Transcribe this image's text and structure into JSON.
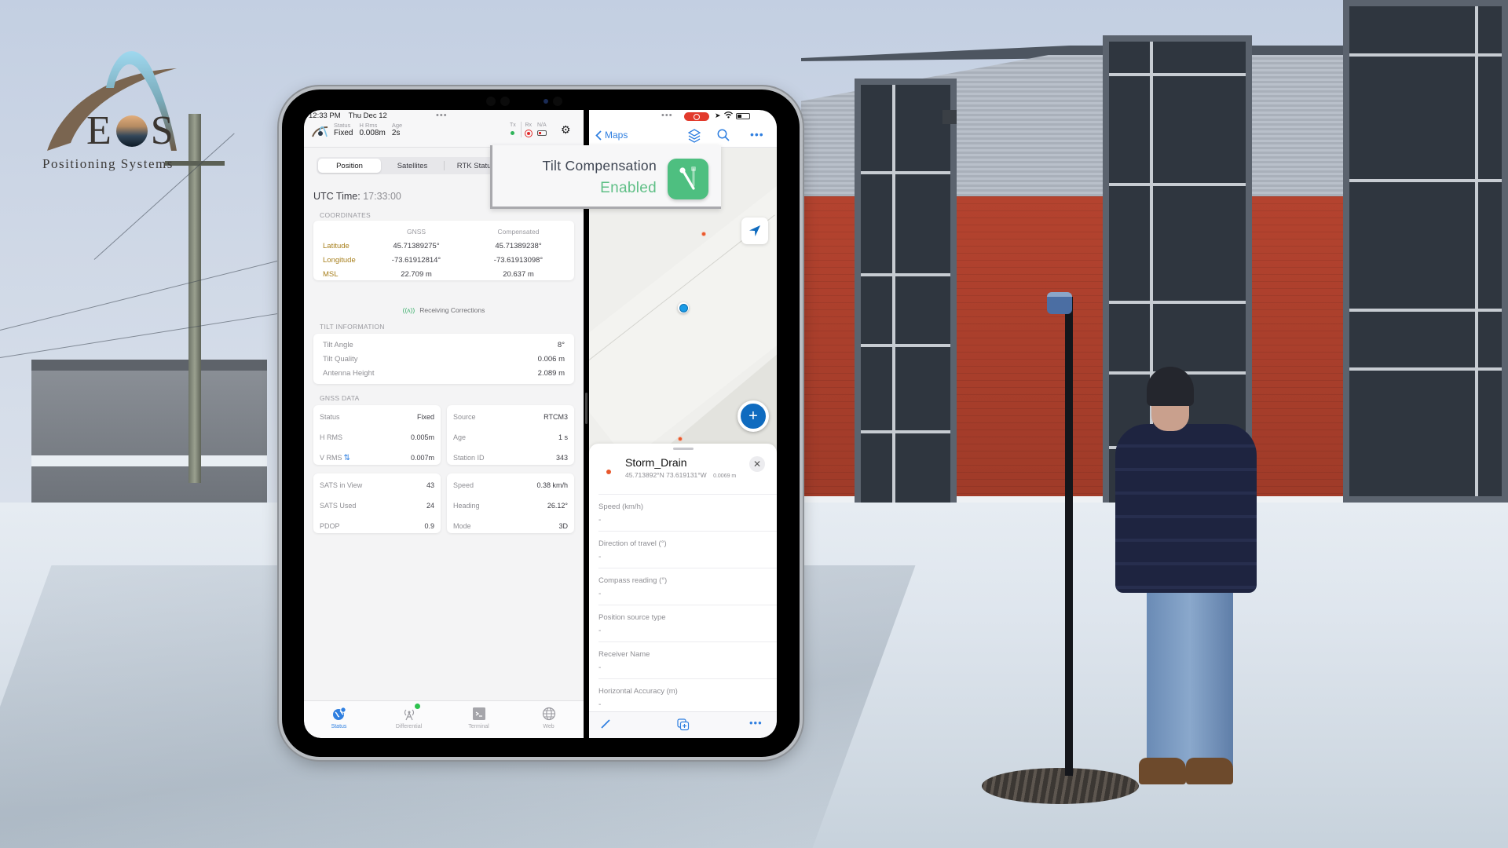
{
  "overlay": {
    "logo": {
      "letters_left": "E",
      "letters_right": "S",
      "tagline": "Positioning Systems"
    },
    "tilt_popup": {
      "title": "Tilt Compensation",
      "status": "Enabled",
      "status_color": "#5fbf86",
      "icon": "tilt-pole-icon"
    }
  },
  "left_app": {
    "statusbar": {
      "time": "12:33 PM",
      "date": "Thu Dec 12"
    },
    "header": {
      "status": {
        "label": "Status",
        "value": "Fixed"
      },
      "hrms": {
        "label": "H Rms",
        "value": "0.008m"
      },
      "age": {
        "label": "Age",
        "value": "2s"
      },
      "indicators": {
        "tx": "Tx",
        "rx": "Rx",
        "na": "N/A"
      },
      "settings_icon": "gears-icon"
    },
    "tabs": [
      {
        "label": "Position",
        "active": true
      },
      {
        "label": "Satellites",
        "active": false
      },
      {
        "label": "RTK Status",
        "active": false
      }
    ],
    "utc": {
      "label": "UTC Time:",
      "value": "17:33:00"
    },
    "coordinates": {
      "section": "COORDINATES",
      "col_gnss": "GNSS",
      "col_comp": "Compensated",
      "rows": [
        {
          "label": "Latitude",
          "gnss": "45.71389275°",
          "comp": "45.71389238°"
        },
        {
          "label": "Longitude",
          "gnss": "-73.61912814°",
          "comp": "-73.61913098°"
        },
        {
          "label": "MSL",
          "gnss": "22.709 m",
          "comp": "20.637 m"
        }
      ]
    },
    "corrections": "Receiving Corrections",
    "tilt": {
      "section": "TILT INFORMATION",
      "rows": [
        {
          "label": "Tilt Angle",
          "value": "8°"
        },
        {
          "label": "Tilt Quality",
          "value": "0.006 m"
        },
        {
          "label": "Antenna Height",
          "value": "2.089 m"
        }
      ]
    },
    "gnss": {
      "section": "GNSS DATA",
      "cards": [
        [
          {
            "label": "Status",
            "value": "Fixed"
          },
          {
            "label": "H RMS",
            "value": "0.005m"
          },
          {
            "label": "V RMS",
            "value": "0.007m"
          }
        ],
        [
          {
            "label": "Source",
            "value": "RTCM3"
          },
          {
            "label": "Age",
            "value": "1 s"
          },
          {
            "label": "Station ID",
            "value": "343"
          }
        ],
        [
          {
            "label": "SATS in View",
            "value": "43"
          },
          {
            "label": "SATS Used",
            "value": "24"
          },
          {
            "label": "PDOP",
            "value": "0.9"
          }
        ],
        [
          {
            "label": "Speed",
            "value": "0.38 km/h"
          },
          {
            "label": "Heading",
            "value": "26.12°"
          },
          {
            "label": "Mode",
            "value": "3D"
          }
        ]
      ]
    },
    "tabbar": [
      {
        "label": "Status",
        "icon": "globe-pin-icon",
        "active": true
      },
      {
        "label": "Differential",
        "icon": "antenna-icon",
        "active": false
      },
      {
        "label": "Terminal",
        "icon": "terminal-icon",
        "active": false
      },
      {
        "label": "Web",
        "icon": "globe-icon",
        "active": false
      }
    ]
  },
  "right_app": {
    "nav": {
      "back_label": "Maps"
    },
    "feature": {
      "title": "Storm_Drain",
      "lat": "45.713892°N",
      "lon": "73.619131°W",
      "accuracy": "0.0069 m"
    },
    "attributes": [
      {
        "label": "Speed (km/h)",
        "value": "-"
      },
      {
        "label": "Direction of travel (°)",
        "value": "-"
      },
      {
        "label": "Compass reading (°)",
        "value": "-"
      },
      {
        "label": "Position source type",
        "value": "-"
      },
      {
        "label": "Receiver Name",
        "value": "-"
      },
      {
        "label": "Horizontal Accuracy (m)",
        "value": "-"
      }
    ],
    "accent": "#2f7fe0"
  }
}
